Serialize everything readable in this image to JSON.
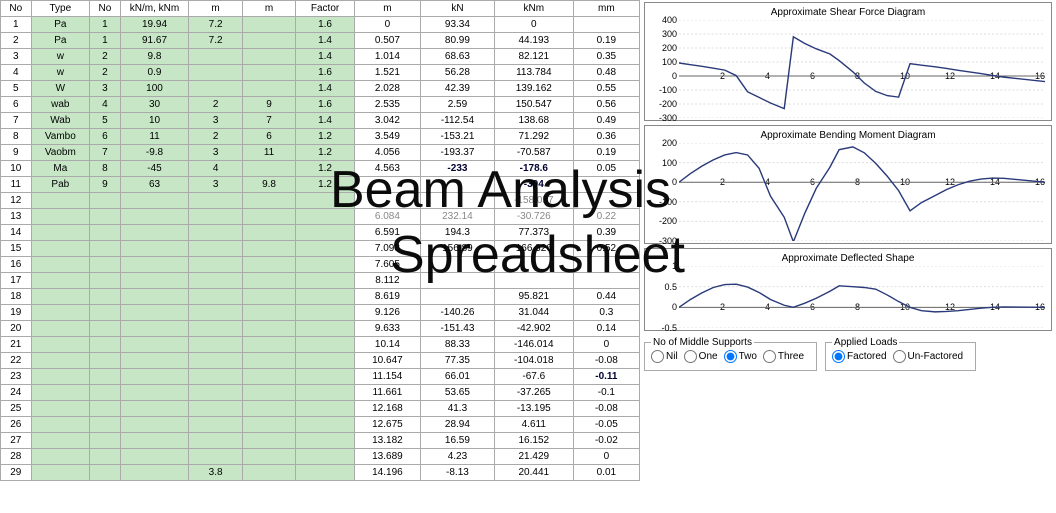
{
  "watermark": {
    "line1": "Beam Analysis",
    "line2": "Spreadsheet"
  },
  "headers": [
    "No",
    "Type",
    "No",
    "kN/m, kNm",
    "m",
    "m",
    "Factor",
    "m",
    "kN",
    "kNm",
    "mm"
  ],
  "rows": [
    {
      "no": 1,
      "type": "Pa",
      "n2": 1,
      "knm": "19.94",
      "m": "7.2",
      "m2": "",
      "f": "1.6",
      "x": "0",
      "kN": "93.34",
      "kNm": "0",
      "mm": ""
    },
    {
      "no": 2,
      "type": "Pa",
      "n2": 1,
      "knm": "91.67",
      "m": "7.2",
      "m2": "",
      "f": "1.4",
      "x": "0.507",
      "kN": "80.99",
      "kNm": "44.193",
      "mm": "0.19"
    },
    {
      "no": 3,
      "type": "w",
      "n2": 2,
      "knm": "9.8",
      "m": "",
      "m2": "",
      "f": "1.4",
      "x": "1.014",
      "kN": "68.63",
      "kNm": "82.121",
      "mm": "0.35"
    },
    {
      "no": 4,
      "type": "w",
      "n2": 2,
      "knm": "0.9",
      "m": "",
      "m2": "",
      "f": "1.6",
      "x": "1.521",
      "kN": "56.28",
      "kNm": "113.784",
      "mm": "0.48"
    },
    {
      "no": 5,
      "type": "W",
      "n2": 3,
      "knm": "100",
      "m": "",
      "m2": "",
      "f": "1.4",
      "x": "2.028",
      "kN": "42.39",
      "kNm": "139.162",
      "mm": "0.55"
    },
    {
      "no": 6,
      "type": "wab",
      "n2": 4,
      "knm": "30",
      "m": "2",
      "m2": "9",
      "f": "1.6",
      "x": "2.535",
      "kN": "2.59",
      "kNm": "150.547",
      "mm": "0.56"
    },
    {
      "no": 7,
      "type": "Wab",
      "n2": 5,
      "knm": "10",
      "m": "3",
      "m2": "7",
      "f": "1.4",
      "x": "3.042",
      "kN": "-112.54",
      "kNm": "138.68",
      "mm": "0.49"
    },
    {
      "no": 8,
      "type": "Vambo",
      "n2": 6,
      "knm": "11",
      "m": "2",
      "m2": "6",
      "f": "1.2",
      "x": "3.549",
      "kN": "-153.21",
      "kNm": "71.292",
      "mm": "0.36"
    },
    {
      "no": 9,
      "type": "Vaobm",
      "n2": 7,
      "knm": "-9.8",
      "m": "3",
      "m2": "11",
      "f": "1.2",
      "x": "4.056",
      "kN": "-193.37",
      "kNm": "-70.587",
      "mm": "0.19"
    },
    {
      "no": 10,
      "type": "Ma",
      "n2": 8,
      "knm": "-45",
      "m": "4",
      "m2": "",
      "f": "1.2",
      "x": "4.563",
      "kN": "-233",
      "kNm": "-178.6",
      "mm": "0.05",
      "bold": true
    },
    {
      "no": 11,
      "type": "Pab",
      "n2": 9,
      "knm": "63",
      "m": "3",
      "m2": "9.8",
      "f": "1.2",
      "x": "",
      "kN": "",
      "kNm": "-304",
      "mm": "",
      "bold": true,
      "neg": true
    },
    {
      "no": 12,
      "type": "",
      "n2": "",
      "knm": "",
      "m": "",
      "m2": "",
      "f": "",
      "x": "",
      "kN": "",
      "kNm": "-158.057",
      "mm": "",
      "grey": true
    },
    {
      "no": 13,
      "type": "",
      "n2": "",
      "knm": "",
      "m": "",
      "m2": "",
      "f": "",
      "x": "6.084",
      "kN": "232.14",
      "kNm": "-30.726",
      "mm": "0.22",
      "grey": true
    },
    {
      "no": 14,
      "type": "",
      "n2": "",
      "knm": "",
      "m": "",
      "m2": "",
      "f": "",
      "x": "6.591",
      "kN": "194.3",
      "kNm": "77.373",
      "mm": "0.39"
    },
    {
      "no": 15,
      "type": "",
      "n2": "",
      "knm": "",
      "m": "",
      "m2": "",
      "f": "",
      "x": "7.098",
      "kN": "156.89",
      "kNm": "166.326",
      "mm": "0.52"
    },
    {
      "no": 16,
      "type": "",
      "n2": "",
      "knm": "",
      "m": "",
      "m2": "",
      "f": "",
      "x": "7.605",
      "kN": "",
      "kNm": "",
      "mm": ""
    },
    {
      "no": 17,
      "type": "",
      "n2": "",
      "knm": "",
      "m": "",
      "m2": "",
      "f": "",
      "x": "8.112",
      "kN": "",
      "kNm": "",
      "mm": ""
    },
    {
      "no": 18,
      "type": "",
      "n2": "",
      "knm": "",
      "m": "",
      "m2": "",
      "f": "",
      "x": "8.619",
      "kN": "",
      "kNm": "95.821",
      "mm": "0.44"
    },
    {
      "no": 19,
      "type": "",
      "n2": "",
      "knm": "",
      "m": "",
      "m2": "",
      "f": "",
      "x": "9.126",
      "kN": "-140.26",
      "kNm": "31.044",
      "mm": "0.3"
    },
    {
      "no": 20,
      "type": "",
      "n2": "",
      "knm": "",
      "m": "",
      "m2": "",
      "f": "",
      "x": "9.633",
      "kN": "-151.43",
      "kNm": "-42.902",
      "mm": "0.14"
    },
    {
      "no": 21,
      "type": "",
      "n2": "",
      "knm": "",
      "m": "",
      "m2": "",
      "f": "",
      "x": "10.14",
      "kN": "88.33",
      "kNm": "-146.014",
      "mm": "0"
    },
    {
      "no": 22,
      "type": "",
      "n2": "",
      "knm": "",
      "m": "",
      "m2": "",
      "f": "",
      "x": "10.647",
      "kN": "77.35",
      "kNm": "-104.018",
      "mm": "-0.08"
    },
    {
      "no": 23,
      "type": "",
      "n2": "",
      "knm": "",
      "m": "",
      "m2": "",
      "f": "",
      "x": "11.154",
      "kN": "66.01",
      "kNm": "-67.6",
      "mm": "-0.11",
      "mmBold": true
    },
    {
      "no": 24,
      "type": "",
      "n2": "",
      "knm": "",
      "m": "",
      "m2": "",
      "f": "",
      "x": "11.661",
      "kN": "53.65",
      "kNm": "-37.265",
      "mm": "-0.1"
    },
    {
      "no": 25,
      "type": "",
      "n2": "",
      "knm": "",
      "m": "",
      "m2": "",
      "f": "",
      "x": "12.168",
      "kN": "41.3",
      "kNm": "-13.195",
      "mm": "-0.08"
    },
    {
      "no": 26,
      "type": "",
      "n2": "",
      "knm": "",
      "m": "",
      "m2": "",
      "f": "",
      "x": "12.675",
      "kN": "28.94",
      "kNm": "4.611",
      "mm": "-0.05"
    },
    {
      "no": 27,
      "type": "",
      "n2": "",
      "knm": "",
      "m": "",
      "m2": "",
      "f": "",
      "x": "13.182",
      "kN": "16.59",
      "kNm": "16.152",
      "mm": "-0.02"
    },
    {
      "no": 28,
      "type": "",
      "n2": "",
      "knm": "",
      "m": "",
      "m2": "",
      "f": "",
      "x": "13.689",
      "kN": "4.23",
      "kNm": "21.429",
      "mm": "0"
    },
    {
      "no": 29,
      "type": "",
      "n2": "",
      "knm": "",
      "m": "3.8",
      "m2": "",
      "f": "",
      "x": "14.196",
      "kN": "-8.13",
      "kNm": "20.441",
      "mm": "0.01"
    }
  ],
  "charts": {
    "shear": {
      "title": "Approximate Shear Force Diagram",
      "yticks": [
        -300,
        -200,
        -100,
        0,
        100,
        200,
        300,
        400
      ],
      "xticks": [
        2,
        4,
        6,
        8,
        10,
        12,
        14,
        16
      ]
    },
    "moment": {
      "title": "Approximate Bending Moment Diagram",
      "yticks": [
        -300,
        -200,
        -100,
        0,
        100,
        200
      ],
      "xticks": [
        2,
        4,
        6,
        8,
        10,
        12,
        14,
        16
      ]
    },
    "deflect": {
      "title": "Approximate Deflected Shape",
      "yticks": [
        -0.5,
        0,
        0.5,
        1
      ],
      "xticks": [
        2,
        4,
        6,
        8,
        10,
        12,
        14,
        16
      ]
    }
  },
  "supports": {
    "legend": "No of Middle Supports",
    "options": [
      "Nil",
      "One",
      "Two",
      "Three"
    ],
    "selected": "Two"
  },
  "loads": {
    "legend": "Applied Loads",
    "options": [
      "Factored",
      "Un-Factored"
    ],
    "selected": "Factored"
  },
  "chart_data": [
    {
      "type": "line",
      "title": "Approximate Shear Force Diagram",
      "xlabel": "",
      "ylabel": "",
      "xlim": [
        0,
        16
      ],
      "ylim": [
        -300,
        400
      ],
      "x": [
        0,
        0.5,
        1,
        1.5,
        2,
        2.5,
        3,
        3.5,
        4,
        4.6,
        5,
        5.5,
        6,
        6.6,
        7,
        7.6,
        8.1,
        8.6,
        9.1,
        9.6,
        10.1,
        10.6,
        11.2,
        11.7,
        12.2,
        12.7,
        13.2,
        13.7,
        14.2,
        16
      ],
      "y": [
        93,
        81,
        69,
        56,
        42,
        3,
        -113,
        -153,
        -193,
        -233,
        280,
        232,
        194,
        157,
        110,
        30,
        -50,
        -110,
        -140,
        -151,
        88,
        77,
        66,
        54,
        41,
        29,
        17,
        4,
        -8,
        -40
      ]
    },
    {
      "type": "line",
      "title": "Approximate Bending Moment Diagram",
      "xlabel": "",
      "ylabel": "",
      "xlim": [
        0,
        16
      ],
      "ylim": [
        -300,
        200
      ],
      "x": [
        0,
        0.5,
        1,
        1.5,
        2,
        2.5,
        3,
        3.5,
        4,
        4.6,
        5,
        5.5,
        6,
        6.6,
        7,
        7.6,
        8.1,
        8.6,
        9.1,
        9.6,
        10.1,
        10.6,
        11.2,
        11.7,
        12.2,
        12.7,
        13.2,
        13.7,
        14.2,
        16
      ],
      "y": [
        0,
        44,
        82,
        114,
        139,
        151,
        139,
        71,
        -71,
        -179,
        -304,
        -158,
        -31,
        77,
        166,
        180,
        150,
        96,
        31,
        -43,
        -146,
        -104,
        -68,
        -37,
        -13,
        5,
        16,
        21,
        20,
        0
      ]
    },
    {
      "type": "line",
      "title": "Approximate Deflected Shape",
      "xlabel": "",
      "ylabel": "",
      "xlim": [
        0,
        16
      ],
      "ylim": [
        -0.5,
        1
      ],
      "x": [
        0,
        0.5,
        1,
        1.5,
        2,
        2.5,
        3,
        3.5,
        4,
        4.6,
        5,
        5.5,
        6,
        6.6,
        7,
        7.6,
        8.1,
        8.6,
        9.1,
        9.6,
        10.1,
        10.6,
        11.2,
        11.7,
        12.2,
        12.7,
        13.2,
        13.7,
        14.2,
        16
      ],
      "y": [
        0,
        0.19,
        0.35,
        0.48,
        0.55,
        0.56,
        0.49,
        0.36,
        0.19,
        0.05,
        0,
        0.1,
        0.22,
        0.39,
        0.52,
        0.5,
        0.48,
        0.44,
        0.3,
        0.14,
        0,
        -0.08,
        -0.11,
        -0.1,
        -0.08,
        -0.05,
        -0.02,
        0,
        0.01,
        0
      ]
    }
  ]
}
